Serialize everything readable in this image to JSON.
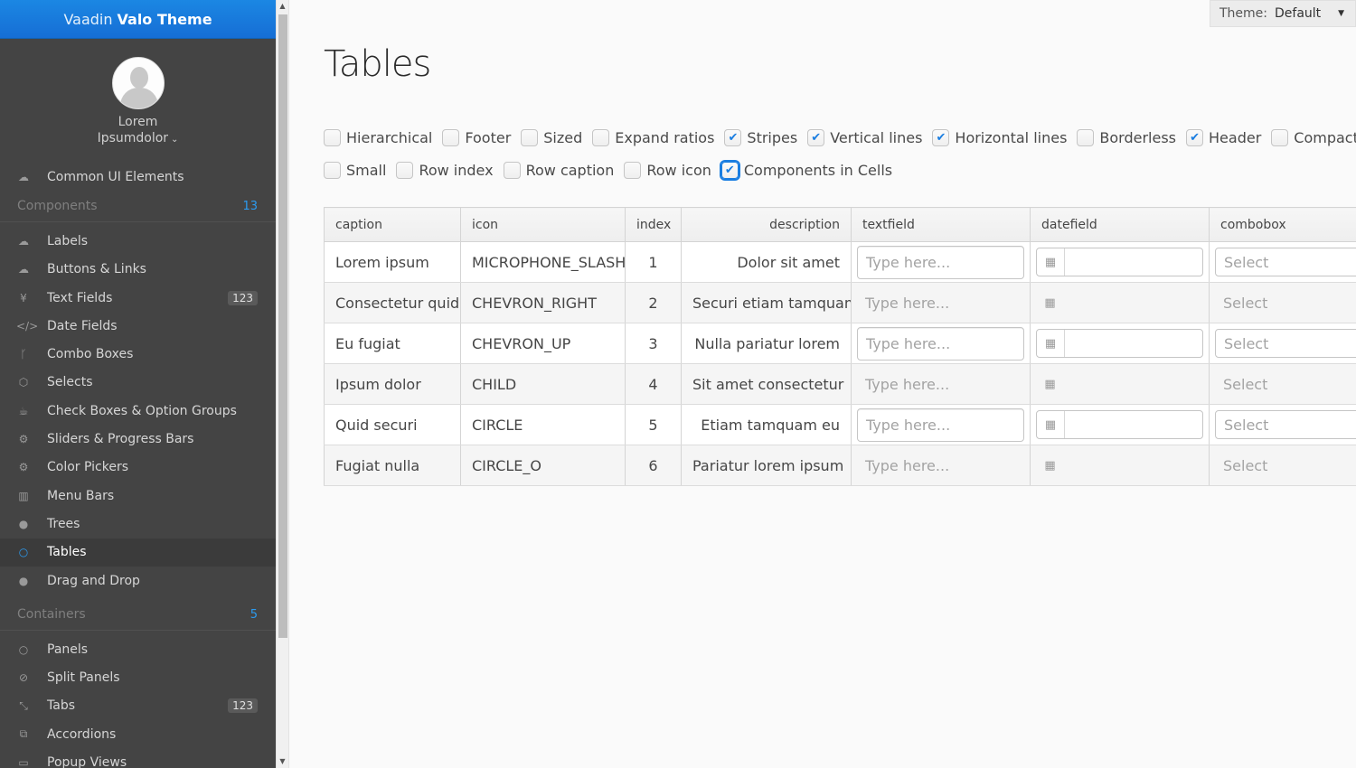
{
  "brand": {
    "light": "Vaadin",
    "bold": "Valo Theme"
  },
  "user": {
    "first": "Lorem",
    "menu": "Ipsumdolor"
  },
  "nav_top": {
    "label": "Common UI Elements",
    "icon": "cloud-icon"
  },
  "sections": [
    {
      "header": "Components",
      "count": "13",
      "items": [
        {
          "label": "Labels",
          "icon": "cloud-icon",
          "glyph": "☁"
        },
        {
          "label": "Buttons & Links",
          "icon": "cloud-upload-icon",
          "glyph": "☁"
        },
        {
          "label": "Text Fields",
          "icon": "yen-icon",
          "glyph": "¥",
          "badge": "123"
        },
        {
          "label": "Date Fields",
          "icon": "code-icon",
          "glyph": "</>"
        },
        {
          "label": "Combo Boxes",
          "icon": "git-branch-icon",
          "glyph": "ᚴ"
        },
        {
          "label": "Selects",
          "icon": "cube-icon",
          "glyph": "⬡"
        },
        {
          "label": "Check Boxes & Option Groups",
          "icon": "coffee-icon",
          "glyph": "☕"
        },
        {
          "label": "Sliders & Progress Bars",
          "icon": "gear-icon",
          "glyph": "⚙"
        },
        {
          "label": "Color Pickers",
          "icon": "gears-icon",
          "glyph": "⚙"
        },
        {
          "label": "Menu Bars",
          "icon": "columns-icon",
          "glyph": "▥"
        },
        {
          "label": "Trees",
          "icon": "comment-icon",
          "glyph": "●"
        },
        {
          "label": "Tables",
          "icon": "comment-outline-icon",
          "glyph": "○",
          "selected": true
        },
        {
          "label": "Drag and Drop",
          "icon": "comments-icon",
          "glyph": "●"
        }
      ]
    },
    {
      "header": "Containers",
      "count": "5",
      "items": [
        {
          "label": "Panels",
          "icon": "comments-outline-icon",
          "glyph": "○"
        },
        {
          "label": "Split Panels",
          "icon": "compass-icon",
          "glyph": "⊘"
        },
        {
          "label": "Tabs",
          "icon": "compress-icon",
          "glyph": "⤡",
          "badge": "123"
        },
        {
          "label": "Accordions",
          "icon": "copy-icon",
          "glyph": "⧉"
        },
        {
          "label": "Popup Views",
          "icon": "credit-card-icon",
          "glyph": "▭"
        }
      ]
    }
  ],
  "theme": {
    "label": "Theme:",
    "value": "Default"
  },
  "page_title": "Tables",
  "options_row1": [
    {
      "label": "Hierarchical",
      "checked": false
    },
    {
      "label": "Footer",
      "checked": false
    },
    {
      "label": "Sized",
      "checked": false
    },
    {
      "label": "Expand ratios",
      "checked": false
    },
    {
      "label": "Stripes",
      "checked": true
    },
    {
      "label": "Vertical lines",
      "checked": true
    },
    {
      "label": "Horizontal lines",
      "checked": true
    },
    {
      "label": "Borderless",
      "checked": false
    },
    {
      "label": "Header",
      "checked": true
    },
    {
      "label": "Compact",
      "checked": false
    }
  ],
  "options_row2": [
    {
      "label": "Small",
      "checked": false
    },
    {
      "label": "Row index",
      "checked": false
    },
    {
      "label": "Row caption",
      "checked": false
    },
    {
      "label": "Row icon",
      "checked": false
    },
    {
      "label": "Components in Cells",
      "checked": true,
      "focused": true
    }
  ],
  "table": {
    "columns": [
      "caption",
      "icon",
      "index",
      "description",
      "textfield",
      "datefield",
      "combobox"
    ],
    "textfield_placeholder": "Type here...",
    "combobox_placeholder": "Select",
    "rows": [
      {
        "caption": "Lorem ipsum",
        "icon": "MICROPHONE_SLASH",
        "index": "1",
        "description": "Dolor sit amet"
      },
      {
        "caption": "Consectetur quid",
        "icon": "CHEVRON_RIGHT",
        "index": "2",
        "description": "Securi etiam tamquam"
      },
      {
        "caption": "Eu fugiat",
        "icon": "CHEVRON_UP",
        "index": "3",
        "description": "Nulla pariatur lorem"
      },
      {
        "caption": "Ipsum dolor",
        "icon": "CHILD",
        "index": "4",
        "description": "Sit amet consectetur"
      },
      {
        "caption": "Quid securi",
        "icon": "CIRCLE",
        "index": "5",
        "description": "Etiam tamquam eu"
      },
      {
        "caption": "Fugiat nulla",
        "icon": "CIRCLE_O",
        "index": "6",
        "description": "Pariatur lorem ipsum"
      }
    ]
  }
}
